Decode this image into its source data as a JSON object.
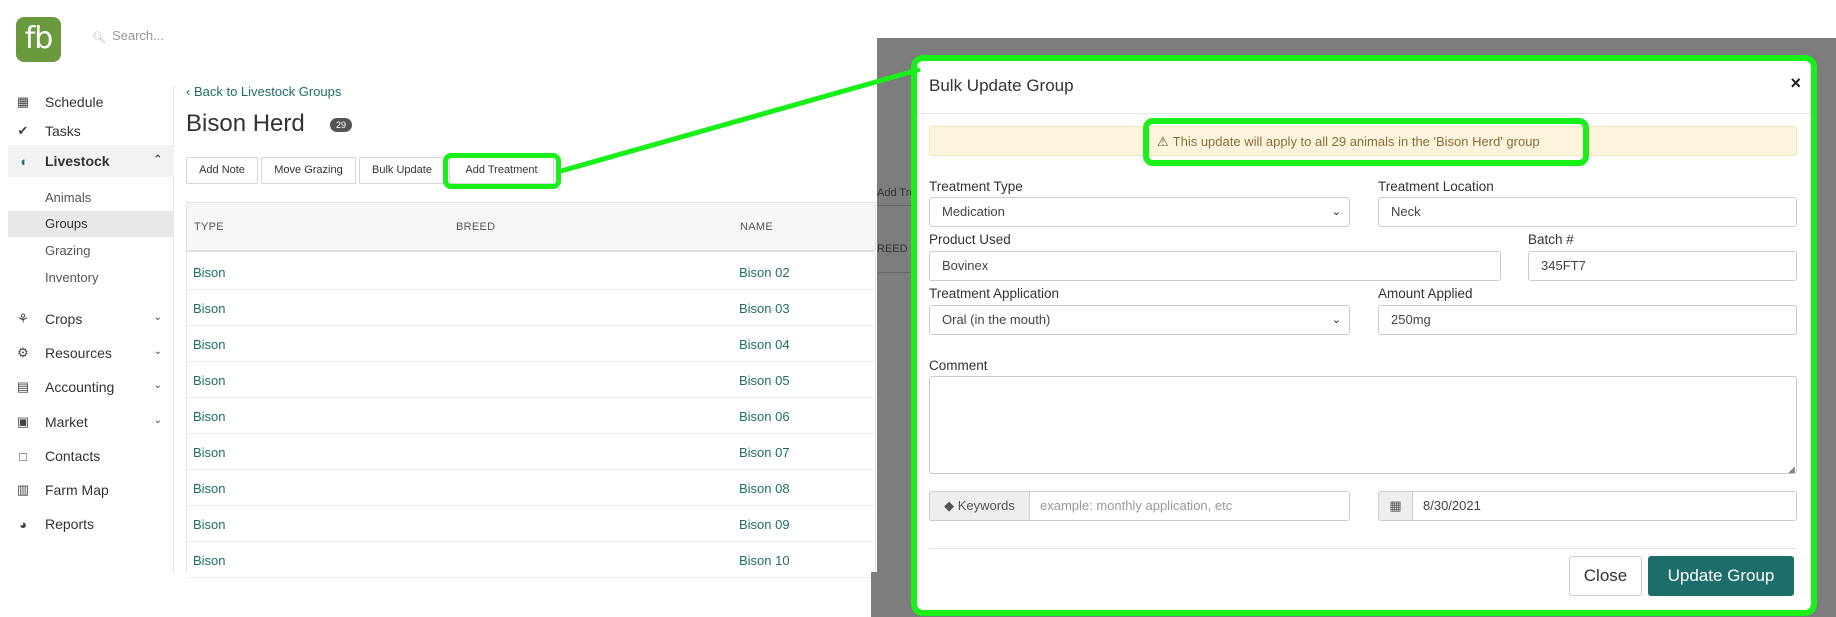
{
  "app": {
    "logo_text": "fb",
    "search_placeholder": "Search..."
  },
  "sidebar": {
    "items": [
      {
        "label": "Schedule",
        "icon": "calendar-icon"
      },
      {
        "label": "Tasks",
        "icon": "check-circle-icon"
      },
      {
        "label": "Livestock",
        "icon": "livestock-icon"
      },
      {
        "label": "Crops",
        "icon": "sprout-icon"
      },
      {
        "label": "Resources",
        "icon": "tractor-icon"
      },
      {
        "label": "Accounting",
        "icon": "calculator-icon"
      },
      {
        "label": "Market",
        "icon": "store-icon"
      },
      {
        "label": "Contacts",
        "icon": "address-book-icon"
      },
      {
        "label": "Farm Map",
        "icon": "map-icon"
      },
      {
        "label": "Reports",
        "icon": "pie-chart-icon"
      }
    ],
    "livestock_sub": [
      "Animals",
      "Groups",
      "Grazing",
      "Inventory"
    ]
  },
  "page": {
    "back_link": "Back to Livestock Groups",
    "title": "Bison Herd",
    "count": "29",
    "buttons": [
      "Add Note",
      "Move Grazing",
      "Bulk Update",
      "Add Treatment"
    ]
  },
  "table": {
    "columns": [
      "TYPE",
      "BREED",
      "NAME"
    ],
    "rows": [
      {
        "type": "Bison",
        "name": "Bison 02"
      },
      {
        "type": "Bison",
        "name": "Bison 03"
      },
      {
        "type": "Bison",
        "name": "Bison 04"
      },
      {
        "type": "Bison",
        "name": "Bison 05"
      },
      {
        "type": "Bison",
        "name": "Bison 06"
      },
      {
        "type": "Bison",
        "name": "Bison 07"
      },
      {
        "type": "Bison",
        "name": "Bison 08"
      },
      {
        "type": "Bison",
        "name": "Bison 09"
      },
      {
        "type": "Bison",
        "name": "Bison 10"
      }
    ]
  },
  "background_ghost": {
    "button_fragment": "Add Tre",
    "column_fragment": "REED"
  },
  "modal": {
    "title": "Bulk Update Group",
    "close_symbol": "×",
    "alert": "This update will apply to all 29 animals in the 'Bison Herd' group",
    "fields": {
      "treatment_type": {
        "label": "Treatment Type",
        "value": "Medication"
      },
      "treatment_location": {
        "label": "Treatment Location",
        "value": "Neck"
      },
      "product_used": {
        "label": "Product Used",
        "value": "Bovinex"
      },
      "batch": {
        "label": "Batch #",
        "value": "345FT7"
      },
      "treatment_application": {
        "label": "Treatment Application",
        "value": "Oral (in the mouth)"
      },
      "amount_applied": {
        "label": "Amount Applied",
        "value": "250mg"
      },
      "comment": {
        "label": "Comment",
        "value": ""
      },
      "keywords": {
        "addon": "Keywords",
        "placeholder": "example: monthly application, etc"
      },
      "date": {
        "value": "8/30/2021"
      }
    },
    "close_button": "Close",
    "submit_button": "Update Group"
  },
  "colors": {
    "brand_teal": "#1d6e6a",
    "logo_green": "#6a9a3b",
    "highlight_green": "#19f01a",
    "alert_bg": "#fcf4dc"
  }
}
